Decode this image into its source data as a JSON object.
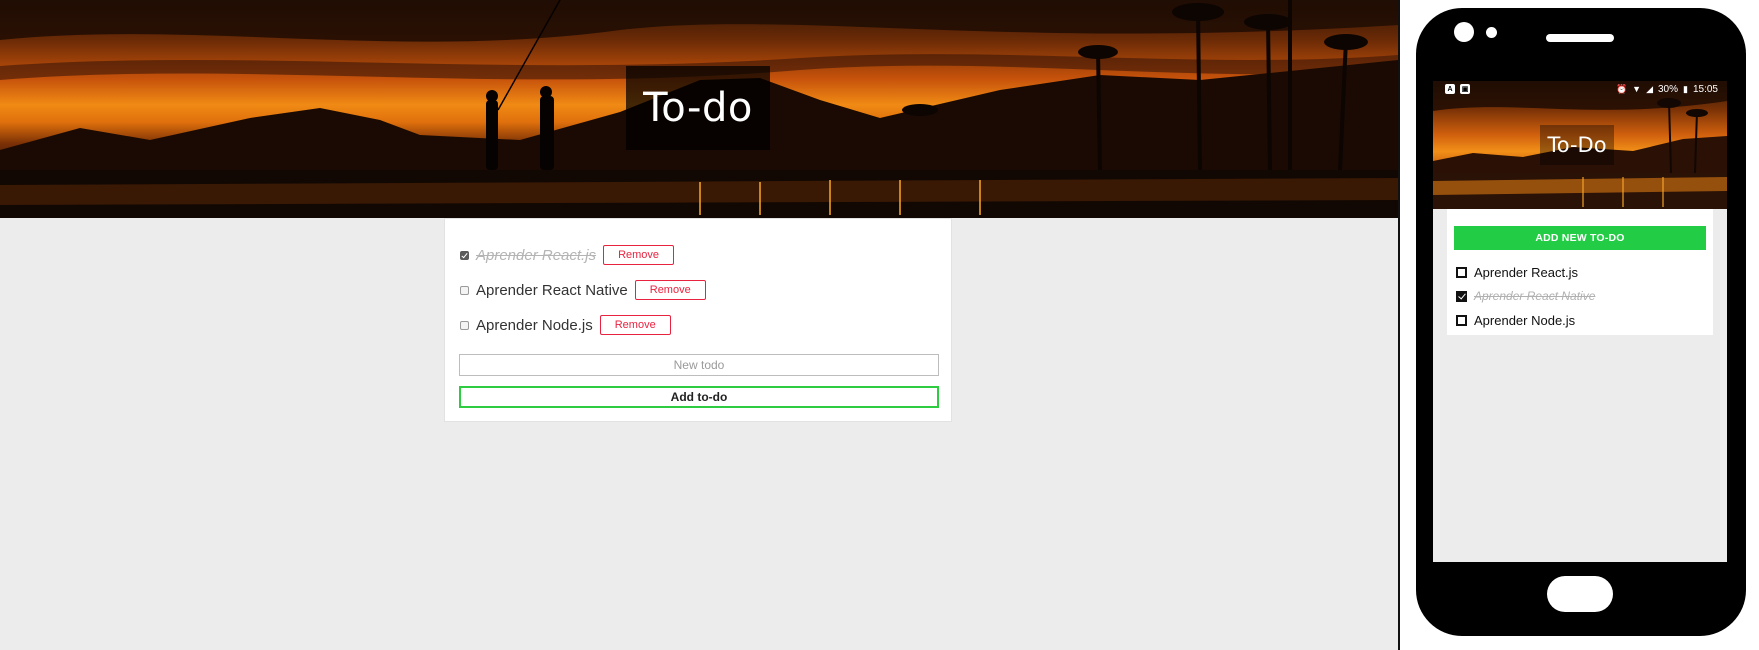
{
  "web": {
    "title": "To-do",
    "todos": [
      {
        "text": "Aprender React.js",
        "done": true,
        "remove_label": "Remove"
      },
      {
        "text": "Aprender React Native",
        "done": false,
        "remove_label": "Remove"
      },
      {
        "text": "Aprender Node.js",
        "done": false,
        "remove_label": "Remove"
      }
    ],
    "new_todo_placeholder": "New todo",
    "new_todo_value": "",
    "add_label": "Add to-do"
  },
  "mobile": {
    "status_bar": {
      "left_icons": [
        "app-notification-icon",
        "image-notification-icon"
      ],
      "right_icons": [
        "alarm-icon",
        "wifi-icon",
        "signal-icon"
      ],
      "battery": "30%",
      "time": "15:05"
    },
    "title": "To-Do",
    "add_label": "ADD NEW TO-DO",
    "todos": [
      {
        "text": "Aprender React.js",
        "done": false
      },
      {
        "text": "Aprender React Native",
        "done": true
      },
      {
        "text": "Aprender Node.js",
        "done": false
      }
    ]
  },
  "colors": {
    "remove_accent": "#e8233f",
    "add_accent": "#2ecc40",
    "mobile_add_bg": "#22cc44",
    "page_bg": "#ececec"
  }
}
